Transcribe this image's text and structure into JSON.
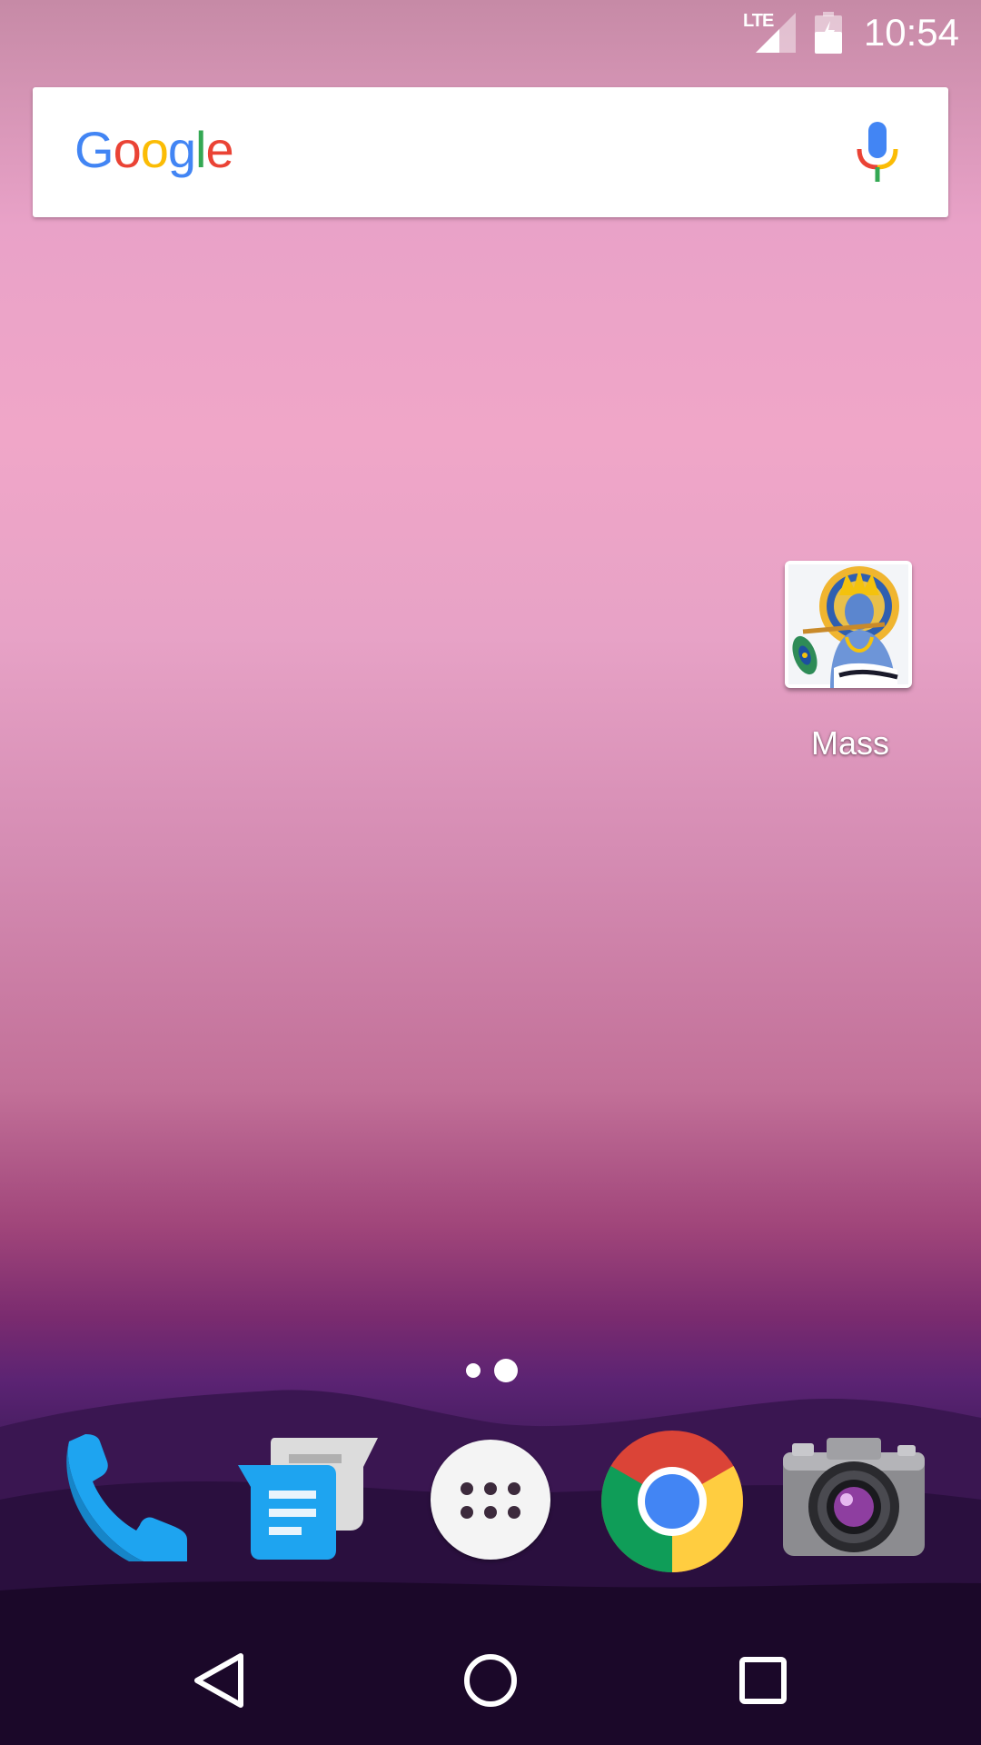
{
  "status_bar": {
    "network_label": "LTE",
    "time": "10:54"
  },
  "search_bar": {
    "logo_letters": [
      {
        "char": "G",
        "color": "#4285F4"
      },
      {
        "char": "o",
        "color": "#EA4335"
      },
      {
        "char": "o",
        "color": "#FBBC05"
      },
      {
        "char": "g",
        "color": "#4285F4"
      },
      {
        "char": "l",
        "color": "#34A853"
      },
      {
        "char": "e",
        "color": "#EA4335"
      }
    ],
    "mic_icon": "microphone-icon"
  },
  "desktop": {
    "apps": [
      {
        "label": "Mass",
        "icon": "krishna-app-icon"
      }
    ]
  },
  "page_indicator": {
    "pages": 2,
    "active_index": 1
  },
  "dock": {
    "items": [
      {
        "icon": "phone-icon"
      },
      {
        "icon": "messages-icon"
      },
      {
        "icon": "app-drawer-icon"
      },
      {
        "icon": "chrome-icon"
      },
      {
        "icon": "camera-icon"
      }
    ]
  },
  "nav_bar": {
    "buttons": [
      {
        "icon": "back-icon"
      },
      {
        "icon": "home-icon"
      },
      {
        "icon": "recents-icon"
      }
    ]
  },
  "colors": {
    "google_blue": "#4285F4",
    "google_red": "#EA4335",
    "google_yellow": "#FBBC05",
    "google_green": "#34A853",
    "phone_blue": "#1EA4F0"
  }
}
